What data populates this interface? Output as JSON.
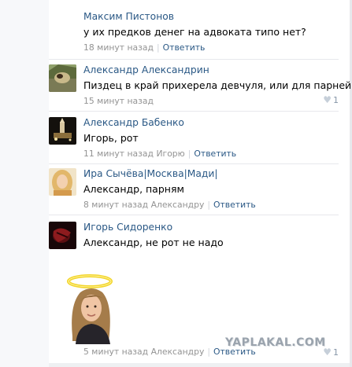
{
  "comments": [
    {
      "author": "Максим Пистонов",
      "text": "у их предков денег на адвоката типо нет?",
      "time": "18 минут назад",
      "reply": "Ответить"
    },
    {
      "author": "Александр Александрин",
      "text": "Пиздец в край прихерела девчуля, или для парней???",
      "time": "15 минут назад",
      "likes": "1"
    },
    {
      "author": "Александр Бабенко",
      "text": "Игорь, рот",
      "time": "11 минут назад",
      "recipient": "Игорю",
      "reply": "Ответить"
    },
    {
      "author": "Ира Сычёва|Москва|Мади|",
      "text": "Александр, парням",
      "time": "8 минут назад",
      "recipient": "Александру",
      "reply": "Ответить"
    },
    {
      "author": "Игорь Сидоренко",
      "text": "Александр, не рот не надо",
      "time": "5 минут назад",
      "recipient": "Александру",
      "reply": "Ответить",
      "likes": "1"
    }
  ],
  "watermark": "YAPLAKAL.COM",
  "colors": {
    "link": "#2a5885",
    "meta": "#939393",
    "divider": "#e7e8ec"
  }
}
